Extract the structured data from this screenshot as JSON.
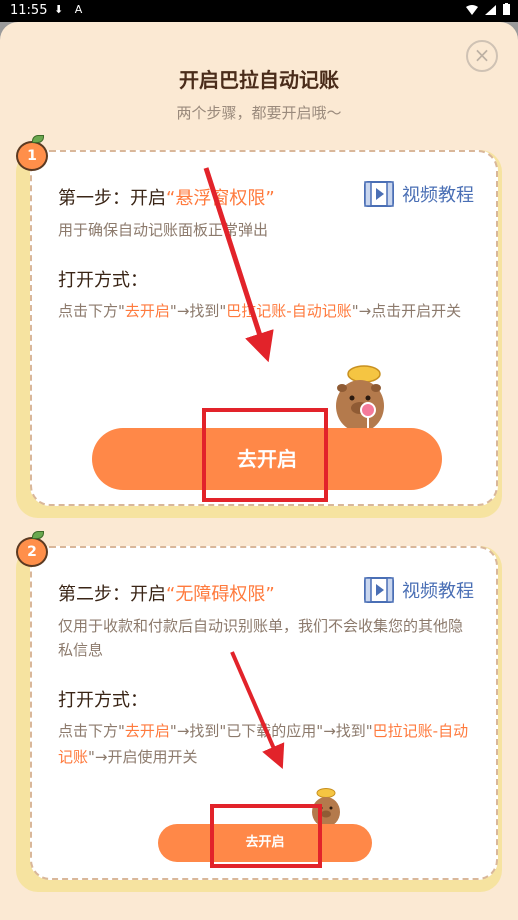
{
  "status_bar": {
    "time": "11:55",
    "left_icons": "⬇ A"
  },
  "sheet": {
    "title": "开启巴拉自动记账",
    "subtitle": "两个步骤，都要开启哦～",
    "close_icon": "×"
  },
  "steps": [
    {
      "number": "1",
      "step_prefix": "第一步：开启",
      "step_highlight": "“悬浮窗权限”",
      "video_label": "视频教程",
      "description": "用于确保自动记账面板正常弹出",
      "method_label": "打开方式：",
      "instr_1": "点击下方\"",
      "instr_hl_1": "去开启",
      "instr_2": "\"→找到\"",
      "instr_hl_2": "巴拉记账-自动记账",
      "instr_3": "\"→点击开启开关",
      "button_label": "去开启"
    },
    {
      "number": "2",
      "step_prefix": "第二步：开启",
      "step_highlight": "“无障碍权限”",
      "video_label": "视频教程",
      "description": "仅用于收款和付款后自动识别账单，我们不会收集您的其他隐私信息",
      "method_label": "打开方式：",
      "instr_1": "点击下方\"",
      "instr_hl_1": "去开启",
      "instr_2": "\"→找到\"已下载的应用\"→找到\"",
      "instr_hl_2": "巴拉记账-自动记账",
      "instr_3": "\"→开启使用开关",
      "button_label": "去开启"
    }
  ],
  "colors": {
    "accent": "#ff8848",
    "highlight": "#ff7a3d",
    "link": "#4a6fb5",
    "annotation": "#e2232a"
  }
}
